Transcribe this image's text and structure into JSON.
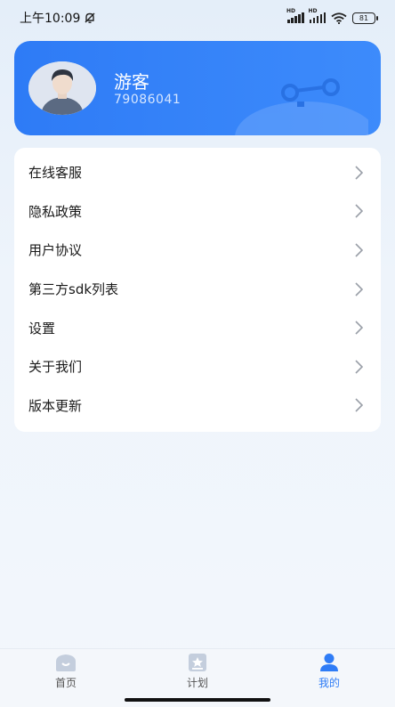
{
  "status_bar": {
    "time": "上午10:09",
    "battery": "81",
    "signal_badge": "HD"
  },
  "profile": {
    "name": "游客",
    "user_id": "79086041"
  },
  "menu": {
    "items": [
      {
        "label": "在线客服"
      },
      {
        "label": "隐私政策"
      },
      {
        "label": "用户协议"
      },
      {
        "label": "第三方sdk列表"
      },
      {
        "label": "设置"
      },
      {
        "label": "关于我们"
      },
      {
        "label": "版本更新"
      }
    ]
  },
  "bottom_nav": {
    "tabs": [
      {
        "label": "首页",
        "icon": "home-icon",
        "active": false
      },
      {
        "label": "计划",
        "icon": "plan-icon",
        "active": false
      },
      {
        "label": "我的",
        "icon": "profile-icon",
        "active": true
      }
    ]
  },
  "colors": {
    "accent": "#2f7cf6",
    "card": "#3385f8",
    "background": "#eaf1fa",
    "inactive_icon": "#c4cedd"
  }
}
